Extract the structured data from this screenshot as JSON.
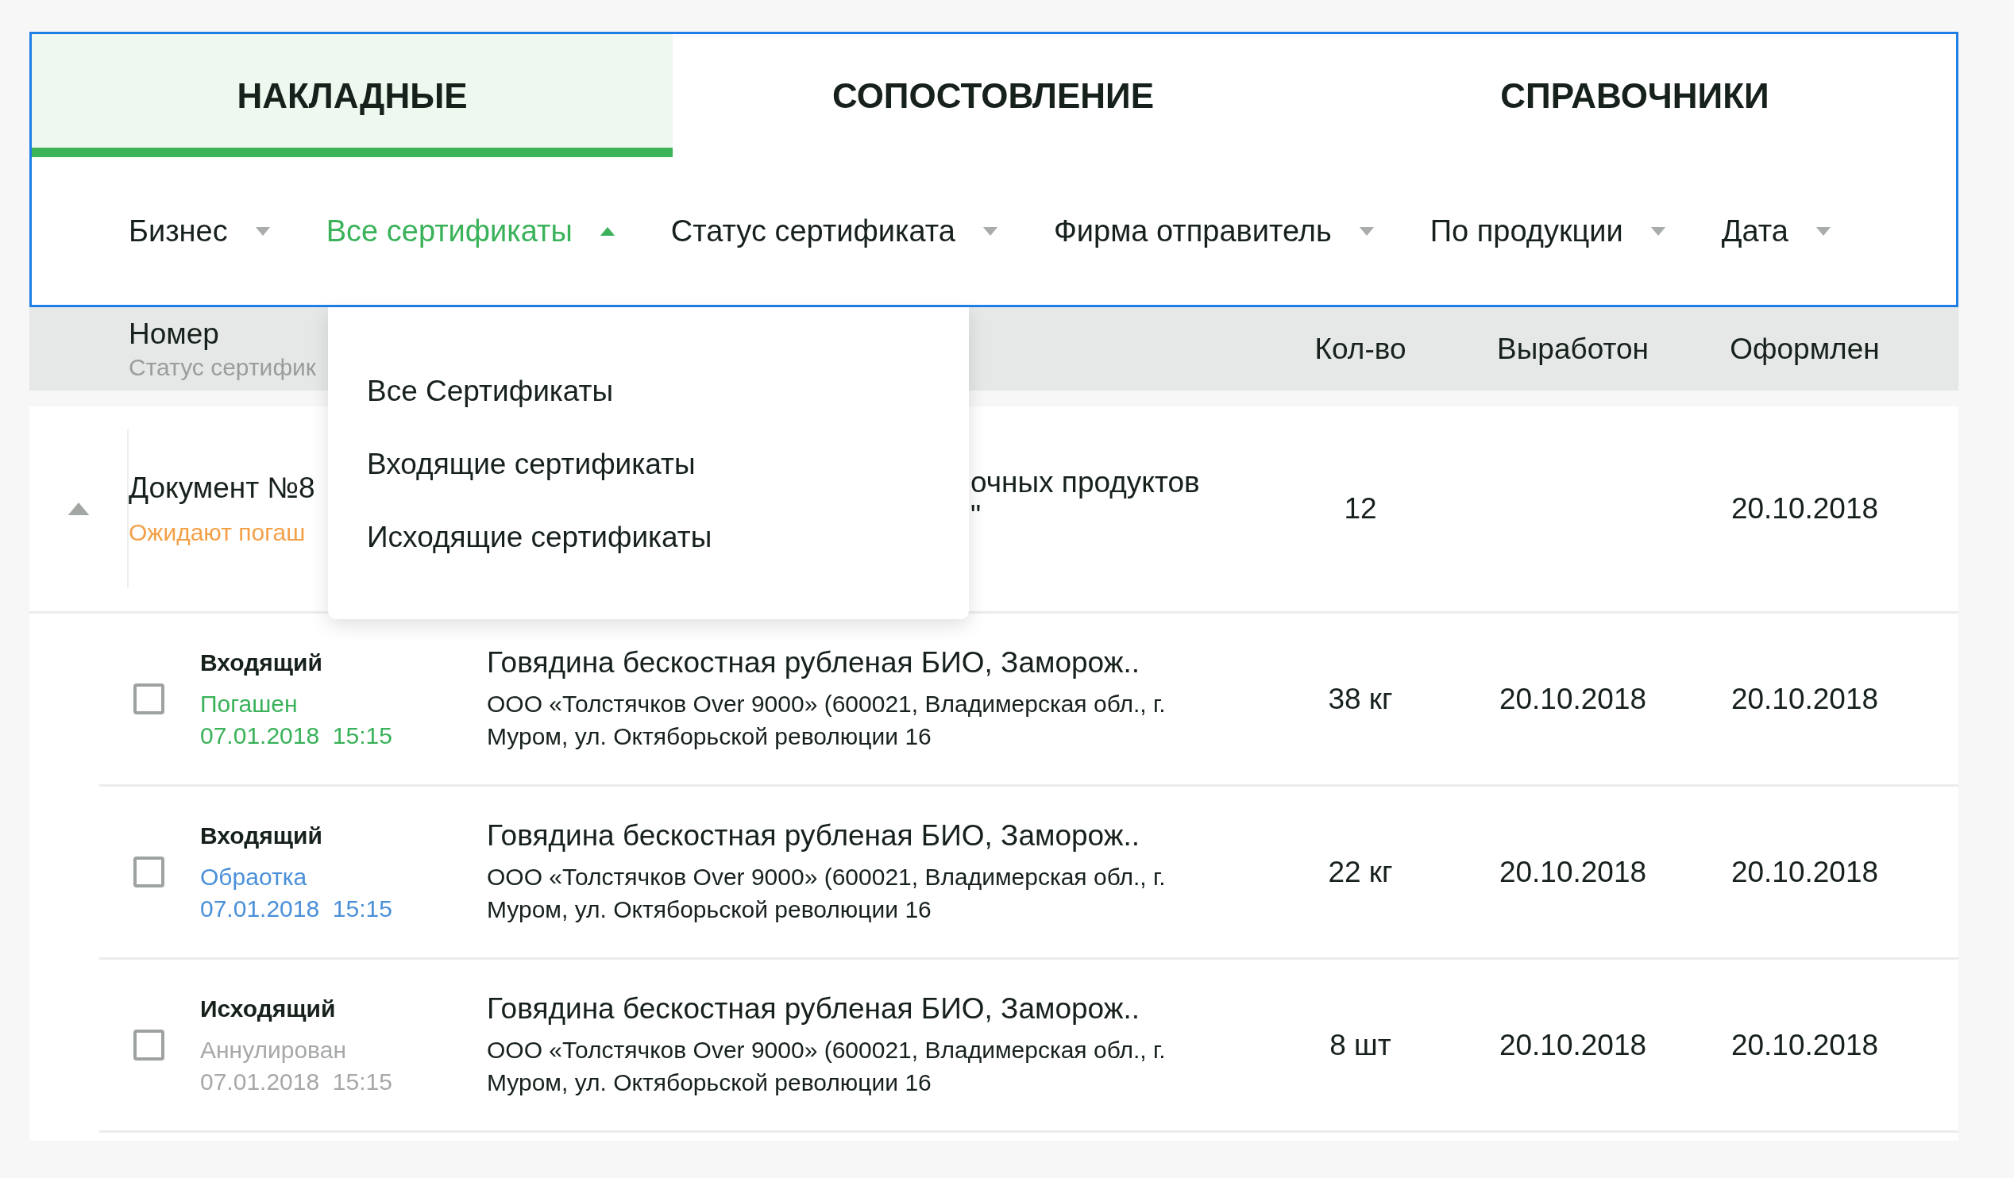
{
  "tabs": [
    {
      "label": "НАКЛАДНЫЕ",
      "selected": true
    },
    {
      "label": "СОПОСТОВЛЕНИЕ",
      "selected": false
    },
    {
      "label": "СПРАВОЧНИКИ",
      "selected": false
    }
  ],
  "filters": [
    {
      "label": "Бизнес",
      "selected": false,
      "expanded": false
    },
    {
      "label": "Все сертификаты",
      "selected": true,
      "expanded": true
    },
    {
      "label": "Статус сертификата",
      "selected": false,
      "expanded": false
    },
    {
      "label": "Фирма отправитель",
      "selected": false,
      "expanded": false
    },
    {
      "label": "По продукции",
      "selected": false,
      "expanded": false
    },
    {
      "label": "Дата",
      "selected": false,
      "expanded": false
    }
  ],
  "dropdown": {
    "items": [
      "Все Сертификаты",
      "Входящие сертификаты",
      "Исходящие сертификаты"
    ]
  },
  "table": {
    "columns": {
      "number": "Номер",
      "number_sub": "Статус сертифик",
      "qty": "Кол-во",
      "produced": "Выработон",
      "issued": "Оформлен"
    },
    "document": {
      "expanded": true,
      "title": "Документ №8",
      "status": "Ожидают погаш",
      "description": [
        "очных продуктов",
        "\""
      ],
      "qty": "12",
      "issued": "20.10.2018"
    },
    "rows": [
      {
        "checked": false,
        "type": "Входящий",
        "status": "Погашен",
        "color": "#3ab25a",
        "datetime": "07.01.2018  15:15",
        "product": "Говядина бескостная рубленая БИО, Заморож..",
        "address": "ООО «Толстячков Over 9000» (600021, Владимерская обл., г. Муром, ул. Октяборьской революции 16",
        "qty": "38 кг",
        "produced": "20.10.2018",
        "issued": "20.10.2018"
      },
      {
        "checked": false,
        "type": "Входящий",
        "status": "Обраотка",
        "color": "#4a90d9",
        "datetime": "07.01.2018  15:15",
        "product": "Говядина бескостная рубленая БИО, Заморож..",
        "address": "ООО «Толстячков Over 9000» (600021, Владимерская обл., г. Муром, ул. Октяборьской революции 16",
        "qty": "22 кг",
        "produced": "20.10.2018",
        "issued": "20.10.2018"
      },
      {
        "checked": false,
        "type": "Исходящий",
        "status": "Аннулирован",
        "color": "#a6a9a7",
        "datetime": "07.01.2018  15:15",
        "product": "Говядина бескостная рубленая БИО, Заморож..",
        "address": "ООО «Толстячков Over 9000» (600021, Владимерская обл., г. Муром, ул. Октяборьской революции 16",
        "qty": "8 шт",
        "produced": "20.10.2018",
        "issued": "20.10.2018"
      }
    ]
  }
}
